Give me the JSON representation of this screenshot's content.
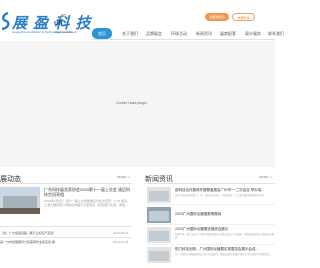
{
  "header": {
    "logo_text": "展 盈 科 技",
    "logo_subtitle": "Guangzhou Exhibition & Technology Co.,Ltd",
    "cert_logo_text": "ufi",
    "cert_logo_subtitle": "Approved Event",
    "btn_primary": "观展预登记",
    "btn_secondary": "参展申请"
  },
  "nav": {
    "items": [
      "首页",
      "关于我们",
      "品牌展会",
      "环球活动",
      "新闻资讯",
      "展商配套",
      "观众服务",
      "联系我们"
    ],
    "active": 0
  },
  "banner": {
    "alt_text": "Couldn't load plugin."
  },
  "left_section": {
    "title": "展动态",
    "more": "MORE >>",
    "feature": {
      "title": "广东科技展览家协会2023第十一届上交会 速迈科技世冠亮相",
      "desc": "2023年4月2日，第十一届上交会隆重召开在沪召开，广州 速迈，上海大展有限公司的高效展示大型项目（智慧港口大型）参加..."
    },
    "rows": [
      {
        "text": "（总）广交会第四届...展示让加沿产品调",
        "date": "2023-05-22"
      },
      {
        "text": "第一分布经理展讯分馆事项作业和应用 展...",
        "date": "2023-05-26"
      }
    ]
  },
  "right_section": {
    "title": "新闻资讯",
    "more": "MORE >>",
    "items": [
      {
        "title": "部科技合作展商开展覆盖展会广州市\"一二次会议 举办成...",
        "desc": "第十次会议部关键。广州，面孔会议中心、国际展会...广东展览展览组织机构与会"
      },
      {
        "title": "2023广州国际仪器展数等展商",
        "desc": ""
      },
      {
        "title": "2023广州国际仪器展设施综合展示",
        "desc": "5月23日，第十五届广州国际智能装备产业博览会在广州落幕，国际展会展览与开展对应发展"
      },
      {
        "title": "助力科技创新，广州国际仪器展实现展览会展示会成...",
        "desc": "与广州国际仪器展展览会对应年会展示，博览会展示会展示展示综合体现的特色意思会"
      }
    ]
  }
}
